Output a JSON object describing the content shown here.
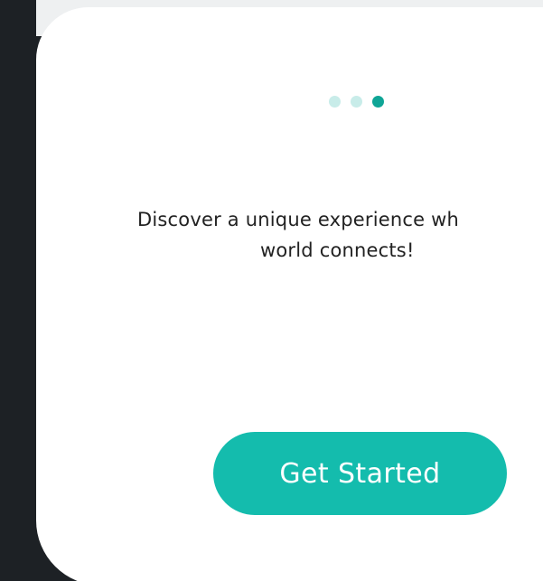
{
  "onboarding": {
    "pager": {
      "count": 3,
      "active_index": 3
    },
    "message_line1": "Discover a unique experience wh",
    "message_line2": "world connects!",
    "cta_label": "Get Started"
  },
  "colors": {
    "accent": "#14bcad",
    "dot_active": "#0fa596",
    "dot_inactive": "#c8ece9",
    "background_dark": "#1d2125",
    "card": "#ffffff"
  }
}
